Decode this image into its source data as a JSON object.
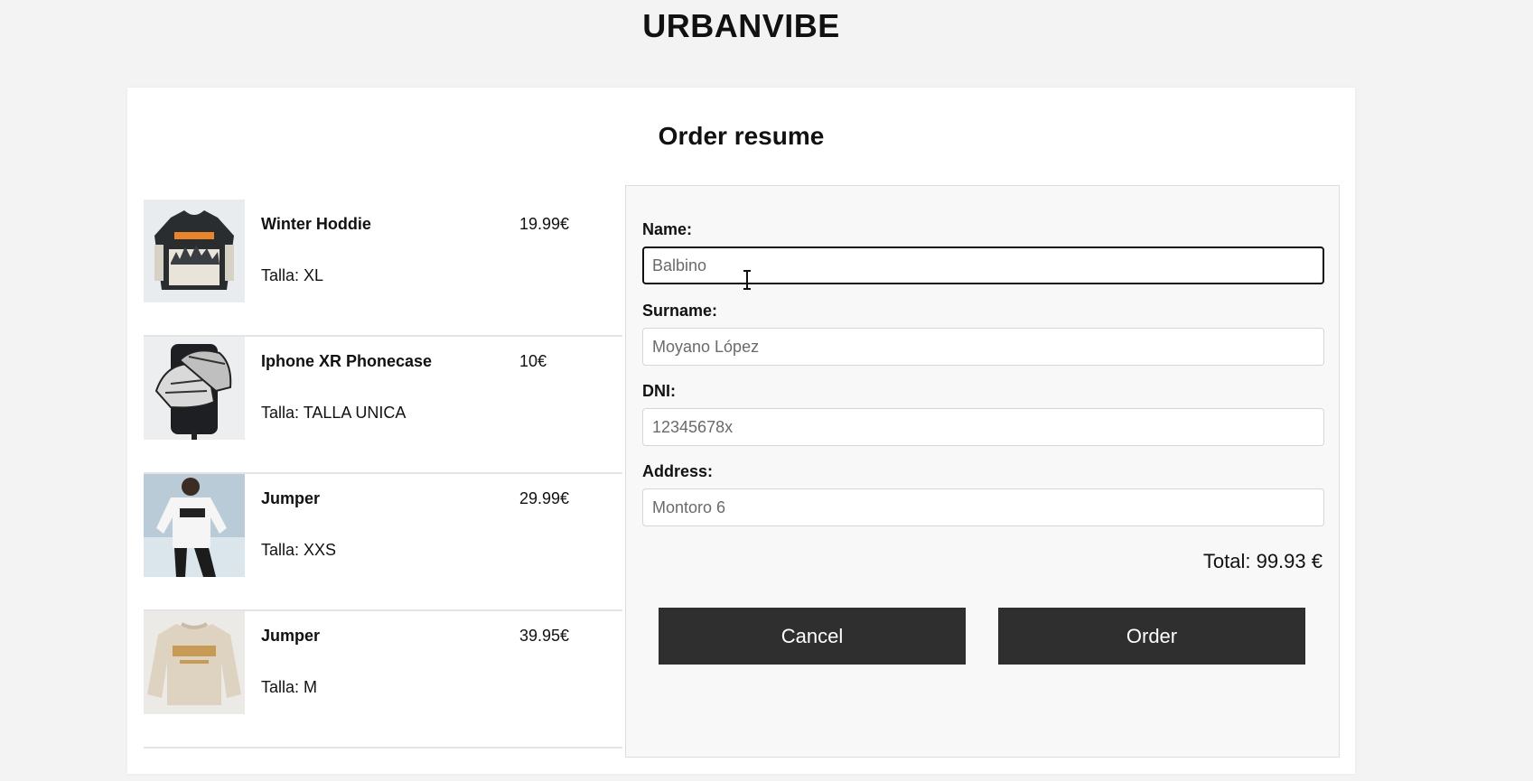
{
  "brand": "URBANVIBE",
  "page_title": "Order resume",
  "items": [
    {
      "name": "Winter Hoddie",
      "size": "Talla: XL",
      "price": "19.99€",
      "image": "winter-hoodie-photo"
    },
    {
      "name": "Iphone XR Phonecase",
      "size": "Talla: TALLA UNICA",
      "price": "10€",
      "image": "phonecase-photo"
    },
    {
      "name": "Jumper",
      "size": "Talla: XXS",
      "price": "29.99€",
      "image": "white-jumper-photo"
    },
    {
      "name": "Jumper",
      "size": "Talla: M",
      "price": "39.95€",
      "image": "beige-jumper-photo"
    }
  ],
  "form": {
    "name": {
      "label": "Name:",
      "value": "Balbino"
    },
    "surname": {
      "label": "Surname:",
      "value": "Moyano López"
    },
    "dni": {
      "label": "DNI:",
      "value": "12345678x"
    },
    "address": {
      "label": "Address:",
      "value": "Montoro 6"
    },
    "total": "Total: 99.93 €",
    "cancel_label": "Cancel",
    "order_label": "Order"
  },
  "colors": {
    "background": "#f3f3f3",
    "card": "#ffffff",
    "panel": "#f8f8f8",
    "button": "#2f2f2f",
    "button_text": "#ffffff"
  },
  "icons": {
    "text_cursor": "i-beam-cursor-icon"
  }
}
